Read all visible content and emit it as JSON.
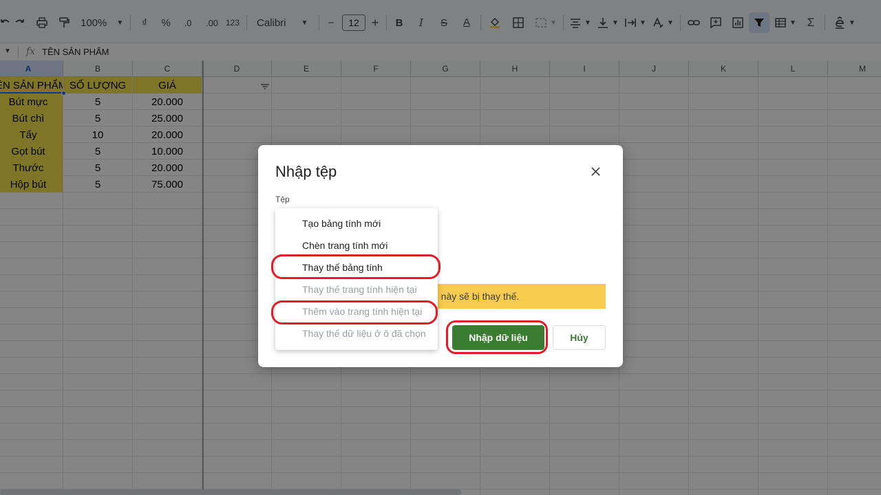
{
  "toolbar": {
    "zoom": "100%",
    "currency": "₫",
    "percent": "%",
    "dec_decrease": ".0",
    "dec_increase": ".00",
    "format_123": "123",
    "font": "Calibri",
    "font_size": "12",
    "minus": "−",
    "plus": "+",
    "bold": "B",
    "italic": "I",
    "strike": "S",
    "text_color": "A",
    "sigma": "Σ"
  },
  "formula_bar": {
    "fx": "fx",
    "value": "TÊN SẢN PHẨM"
  },
  "columns": [
    "A",
    "B",
    "C",
    "D",
    "E",
    "F",
    "G",
    "H",
    "I",
    "J",
    "K",
    "L",
    "M"
  ],
  "sheet": {
    "headers": [
      "TÊN SẢN PHẨM",
      "SỐ LƯỢNG",
      "GIÁ"
    ],
    "rows": [
      [
        "Bút mực",
        "5",
        "20.000"
      ],
      [
        "Bút chì",
        "5",
        "25.000"
      ],
      [
        "Tẩy",
        "10",
        "20.000"
      ],
      [
        "Gọt bút",
        "5",
        "10.000"
      ],
      [
        "Thước",
        "5",
        "20.000"
      ],
      [
        "Hộp bút",
        "5",
        "75.000"
      ]
    ]
  },
  "dialog": {
    "title": "Nhập tệp",
    "file_label": "Tệp",
    "warning": "n này sẽ bị thay thế.",
    "import_button": "Nhập dữ liệu",
    "cancel_button": "Hủy",
    "menu": [
      {
        "label": "Tạo bảng tính mới",
        "enabled": true
      },
      {
        "label": "Chèn trang tính mới",
        "enabled": true
      },
      {
        "label": "Thay thế bảng tính",
        "enabled": true
      },
      {
        "label": "Thay thế trang tính hiện tại",
        "enabled": false
      },
      {
        "label": "Thêm vào trang tính hiện tại",
        "enabled": false
      },
      {
        "label": "Thay thế dữ liệu ở ô đã chọn",
        "enabled": false
      }
    ]
  },
  "colors": {
    "header_fill": "#f4e14a",
    "accent_green": "#3a7d32",
    "highlight_red": "#e11d2a",
    "warning_yellow": "#f7cb4d"
  }
}
